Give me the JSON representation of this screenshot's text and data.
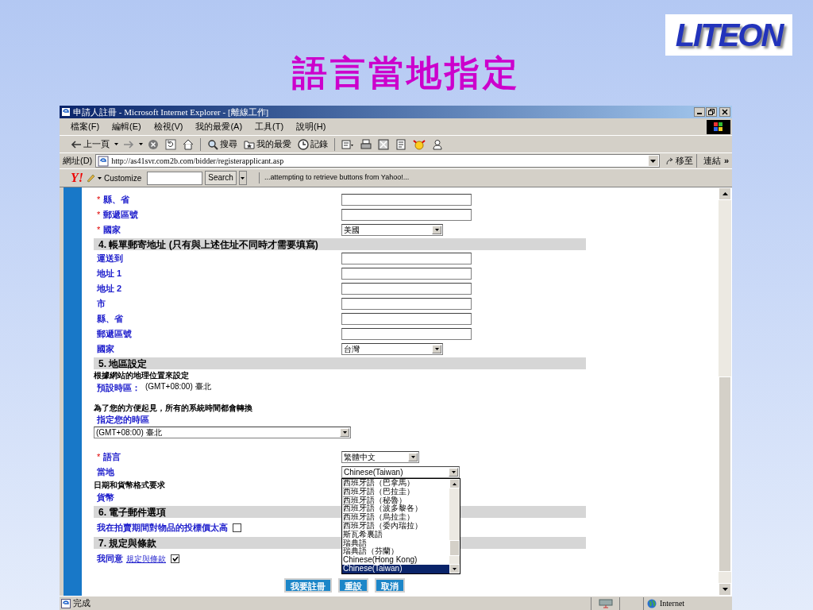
{
  "slide": {
    "title": "語言當地指定",
    "logo": "LITEON"
  },
  "window": {
    "title": "申請人註冊 - Microsoft Internet Explorer - [離線工作]"
  },
  "menu": [
    "檔案(F)",
    "編輯(E)",
    "檢視(V)",
    "我的最愛(A)",
    "工具(T)",
    "說明(H)"
  ],
  "toolbar": [
    {
      "kind": "back",
      "label": "上一頁"
    },
    {
      "kind": "forward"
    },
    {
      "kind": "stop"
    },
    {
      "kind": "refresh"
    },
    {
      "kind": "home"
    },
    {
      "kind": "search",
      "label": "搜尋"
    },
    {
      "kind": "favorites",
      "label": "我的最愛"
    },
    {
      "kind": "history",
      "label": "記錄"
    },
    {
      "kind": "mail"
    },
    {
      "kind": "print"
    },
    {
      "kind": "edit"
    },
    {
      "kind": "discuss"
    },
    {
      "kind": "messenger"
    },
    {
      "kind": "user"
    }
  ],
  "address_bar": {
    "label": "網址(D)",
    "url": "http://as41svr.com2b.com/bidder/registerapplicant.asp",
    "go": "移至",
    "links": "連結",
    "more": "»"
  },
  "yahoo_bar": {
    "logo": "Y!",
    "customize": "Customize",
    "search_button": "Search",
    "message": "...attempting to retrieve buttons from Yahoo!..."
  },
  "form": [
    {
      "kind": "row",
      "marker": "*",
      "label": "縣、省",
      "control": {
        "kind": "text"
      }
    },
    {
      "kind": "row",
      "marker": "*",
      "label": "郵遞區號",
      "control": {
        "kind": "text"
      }
    },
    {
      "kind": "row",
      "marker": "*",
      "label": "國家",
      "control": {
        "kind": "select",
        "value": "美國"
      }
    },
    {
      "kind": "section",
      "title": "4. 帳單郵寄地址 (只有與上述住址不同時才需要填寫)"
    },
    {
      "kind": "row",
      "label": "運送到",
      "control": {
        "kind": "text"
      }
    },
    {
      "kind": "row",
      "label": "地址 1",
      "control": {
        "kind": "text"
      }
    },
    {
      "kind": "row",
      "label": "地址 2",
      "control": {
        "kind": "text"
      }
    },
    {
      "kind": "row",
      "label": "市",
      "control": {
        "kind": "text"
      }
    },
    {
      "kind": "row",
      "label": "縣、省",
      "control": {
        "kind": "text"
      }
    },
    {
      "kind": "row",
      "label": "郵遞區號",
      "control": {
        "kind": "text"
      }
    },
    {
      "kind": "row",
      "label": "國家",
      "control": {
        "kind": "select",
        "value": "台灣"
      }
    },
    {
      "kind": "section",
      "title": "5. 地區設定"
    },
    {
      "kind": "note",
      "text": "根據網站的地理位置來設定"
    },
    {
      "kind": "info",
      "label": "預設時區：",
      "value": "(GMT+08:00) 臺北"
    },
    {
      "kind": "note",
      "text": "為了您的方便起見，所有的系統時間都會轉換"
    },
    {
      "kind": "wide_select",
      "label": "指定您的時區",
      "value": "(GMT+08:00) 臺北"
    },
    {
      "kind": "row",
      "marker": "*",
      "label": "語言",
      "control": {
        "kind": "select",
        "value": "繁體中文"
      }
    },
    {
      "kind": "row",
      "label": "當地",
      "control": {
        "kind": "select",
        "value": "Chinese(Taiwan)",
        "options": [
          {
            "label": "西班牙語（巴拿馬）",
            "selected": false
          },
          {
            "label": "西班牙語（巴拉圭）",
            "selected": false
          },
          {
            "label": "西班牙語（秘魯）",
            "selected": false
          },
          {
            "label": "西班牙語（波多黎各）",
            "selected": false
          },
          {
            "label": "西班牙語（烏拉圭）",
            "selected": false
          },
          {
            "label": "西班牙語（委內瑞拉）",
            "selected": false
          },
          {
            "label": "斯瓦希裏語",
            "selected": false
          },
          {
            "label": "瑞典語",
            "selected": false
          },
          {
            "label": "瑞典語（芬蘭）",
            "selected": false
          },
          {
            "label": "Chinese(Hong Kong)",
            "selected": false
          },
          {
            "label": "Chinese(Taiwan)",
            "selected": true
          }
        ]
      }
    },
    {
      "kind": "note",
      "text": "日期和貨幣格式要求"
    },
    {
      "kind": "row",
      "label": "貨幣"
    },
    {
      "kind": "section",
      "title": "6. 電子郵件選項"
    },
    {
      "kind": "check",
      "label": "我在拍賣期間對物品的投標價太高",
      "checked": false
    },
    {
      "kind": "section",
      "title": "7. 規定與條款"
    },
    {
      "kind": "check",
      "label": "我同意",
      "link": "規定與條款",
      "checked": true
    }
  ],
  "buttons": [
    "我要註冊",
    "重設",
    "取消"
  ],
  "status_bar": {
    "text": "完成",
    "zone": "Internet"
  }
}
